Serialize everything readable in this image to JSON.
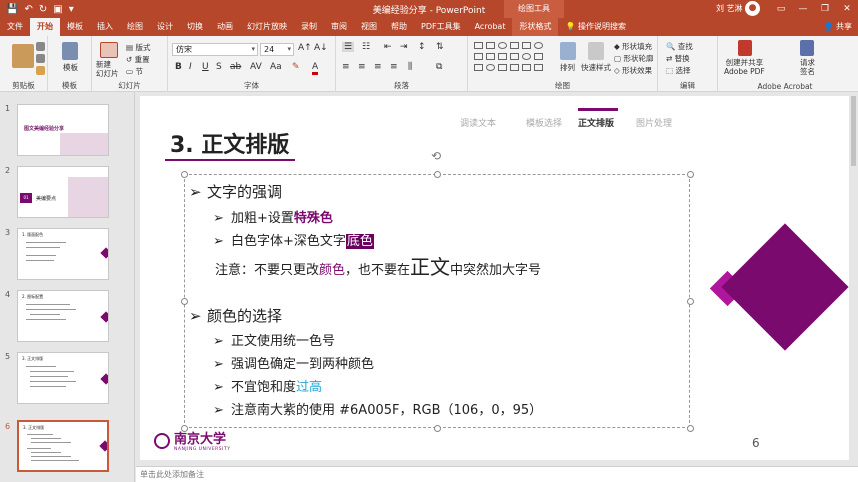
{
  "window": {
    "doc_title": "美编经验分享 - PowerPoint",
    "context_tool": "绘图工具",
    "user": "刘 艺淋",
    "minimize": "—",
    "restore": "❐",
    "close": "✕"
  },
  "tabs": {
    "items": [
      "文件",
      "开始",
      "模板",
      "插入",
      "绘图",
      "设计",
      "切换",
      "动画",
      "幻灯片放映",
      "录制",
      "审阅",
      "视图",
      "帮助",
      "PDF工具集",
      "Acrobat",
      "形状格式",
      "操作说明搜索"
    ],
    "share": "共享"
  },
  "ribbon": {
    "groups": {
      "clipboard": "剪贴板",
      "template": "模板",
      "slides": "幻灯片",
      "font": "字体",
      "paragraph": "段落",
      "drawing": "绘图",
      "editing": "编辑",
      "adobe": "Adobe Acrobat"
    },
    "template_btn": "模板",
    "new_slide": "新建\n幻灯片",
    "layout": "版式",
    "reset": "重置",
    "section": "节",
    "font_name": "仿宋",
    "font_size": "24",
    "arrange": "排列",
    "quick_styles": "快速样式",
    "shape_fill": "形状填充",
    "shape_outline": "形状轮廓",
    "shape_effects": "形状效果",
    "find": "查找",
    "replace": "替换",
    "select": "选择",
    "create_share": "创建并共享\nAdobe PDF",
    "request_sign": "请求\n签名"
  },
  "thumbnails": {
    "numbers": [
      "1",
      "2",
      "3",
      "4",
      "5",
      "6"
    ],
    "t1_title": "图文美编经验分享",
    "t2_num": "01",
    "t2_title": "美编要点",
    "t3_title": "1. 版面配色",
    "t4_title": "2. 图标配置",
    "t5_title": "3. 正文排版",
    "t6_title": "3. 正文排版"
  },
  "slide": {
    "title": "3. 正文排版",
    "nav": [
      "调读文本",
      "模板选择",
      "正文排版",
      "图片处理"
    ],
    "nav_active_index": 2,
    "lines": {
      "h1": "文字的强调",
      "s1a": "加粗+设置",
      "s1b": "特殊色",
      "s2a": "白色字体+深色文字",
      "s2b": "底色",
      "note_a": "注意：不要只更改",
      "note_b": "颜色",
      "note_c": "，也不要在",
      "note_d": "正文",
      "note_e": "中突然加大字号",
      "h2": "颜色的选择",
      "c1": "正文使用统一色号",
      "c2": "强调色确定一到两种颜色",
      "c3a": "不宜饱和度",
      "c3b": "过高",
      "c4": "注意南大紫的使用 #6A005F，RGB（106，0，95）"
    },
    "bullet": "➢",
    "logo": "南京大学",
    "logo_sub": "NANJING UNIVERSITY",
    "page_number": "6"
  },
  "notes": "单击此处添加备注",
  "colors": {
    "accent": "#b7472a",
    "purple": "#7a0a6e",
    "nju_purple": "#6A005F"
  }
}
